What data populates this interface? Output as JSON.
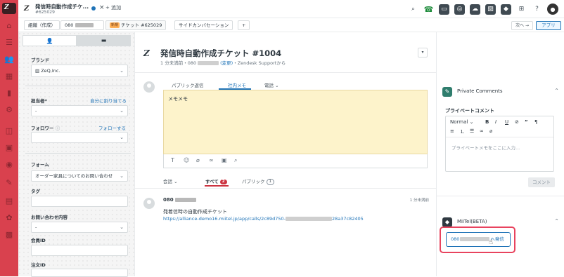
{
  "top_tab": {
    "title": "発信時自動作成チケ...",
    "subtitle": "#625029",
    "add_label": "+ 追加"
  },
  "breadcrumb": {
    "org": "組織（作成）",
    "phone_prefix": "080",
    "ticket_badge": "新規",
    "ticket": "チケット #625029",
    "side_conv": "サイドカンバセーション",
    "plus": "+",
    "next": "次へ →",
    "apps": "アプリ"
  },
  "properties": {
    "brand_label": "ブランド",
    "brand_value": "ZeQ,Inc.",
    "assignee_label": "担当者*",
    "assign_self": "自分に割り当てる",
    "assignee_value": "-",
    "follower_label": "フォロワー",
    "follow_link": "フォローする",
    "form_label": "フォーム",
    "form_value": "オーダー家具についてのお問い合わせ",
    "tag_label": "タグ",
    "inquiry_label": "お問い合わせ内容",
    "inquiry_value": "-",
    "member_label": "会員ID",
    "order_label": "注文ID"
  },
  "ticket": {
    "title": "発信時自動作成チケット #1004",
    "meta_prefix": "1 分未満前・080",
    "meta_change": "(変更)",
    "meta_suffix": "・Zendesk Supportから",
    "more": "▾"
  },
  "composer": {
    "tab_public": "パブリック返信",
    "tab_internal": "社内メモ",
    "tab_phone": "電話",
    "text": "メモメモ"
  },
  "filters": {
    "conversation": "会話",
    "all": "すべて",
    "all_count": "2",
    "public": "パブリック",
    "public_count": "1"
  },
  "message": {
    "from": "080",
    "time": "1 分未満前",
    "body": "発着信時の自動作成チケット",
    "link_a": "https://alliance-demo16.miitel.jp/app/calls/2c89d750-",
    "link_b": "28a37c82405"
  },
  "apps": {
    "private_comments": "Private Comments",
    "private_label": "プライベートコメント",
    "normal": "Normal",
    "placeholder": "プライベートメモをここに入力...",
    "comment_btn": "コメント",
    "miitel": "MiiTel(BETA)",
    "call_prefix": "080",
    "call_suffix": "へ発信"
  },
  "colors": {
    "nav": "#d9414e",
    "accent": "#1f73b7",
    "memo_bg": "#fdf3cb",
    "highlight": "#e8435e"
  }
}
